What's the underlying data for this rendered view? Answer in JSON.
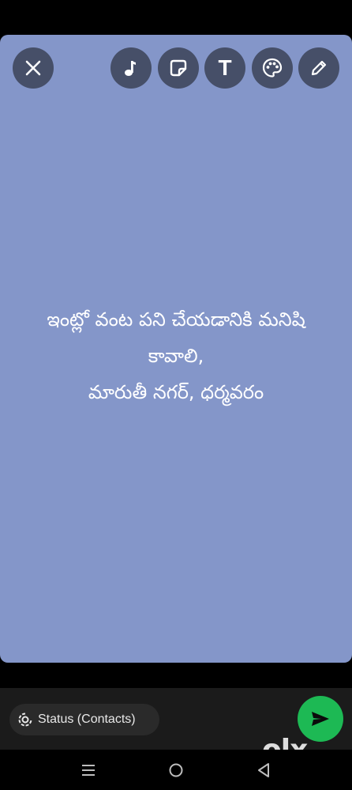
{
  "toolbar": {
    "close_icon": "close-icon",
    "music_icon": "music-note-icon",
    "sticker_icon": "sticker-icon",
    "text_icon": "text-icon",
    "text_icon_glyph": "T",
    "palette_icon": "palette-icon",
    "pencil_icon": "pencil-icon"
  },
  "canvas": {
    "background_color": "#8496c9",
    "message_lines": [
      "ఇంట్లో వంట పని చేయడానికి మనిషి",
      "కావాలి,",
      "మారుతీ నగర్, ధర్మవరం"
    ]
  },
  "compose": {
    "audience_label": "Status (Contacts)",
    "audience_icon": "status-icon",
    "send_icon": "send-icon",
    "send_color": "#1db954"
  },
  "watermark": {
    "text": "olx"
  },
  "nav": {
    "recents_icon": "recents-icon",
    "home_icon": "home-icon",
    "back_icon": "back-icon"
  }
}
